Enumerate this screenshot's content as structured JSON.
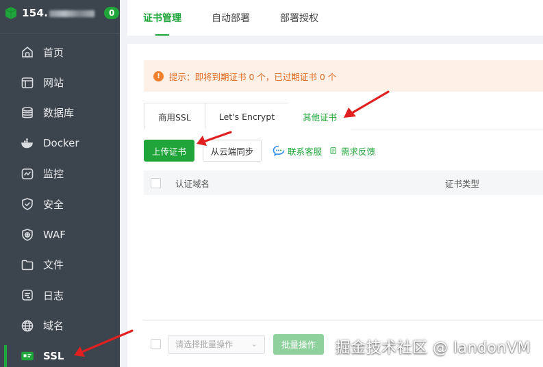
{
  "sidebar": {
    "host_prefix": "154.",
    "badge": "0",
    "items": [
      {
        "label": "首页",
        "icon": "home-icon"
      },
      {
        "label": "网站",
        "icon": "website-icon"
      },
      {
        "label": "数据库",
        "icon": "database-icon"
      },
      {
        "label": "Docker",
        "icon": "docker-icon"
      },
      {
        "label": "监控",
        "icon": "monitor-icon"
      },
      {
        "label": "安全",
        "icon": "shield-icon"
      },
      {
        "label": "WAF",
        "icon": "waf-icon"
      },
      {
        "label": "文件",
        "icon": "folder-icon"
      },
      {
        "label": "日志",
        "icon": "log-icon"
      },
      {
        "label": "域名",
        "icon": "globe-icon"
      },
      {
        "label": "SSL",
        "icon": "ssl-icon",
        "active": true
      }
    ]
  },
  "top_tabs": [
    {
      "label": "证书管理",
      "active": true
    },
    {
      "label": "自动部署"
    },
    {
      "label": "部署授权"
    }
  ],
  "alert": {
    "text": "提示：即将到期证书 0 个，已过期证书 0 个"
  },
  "sub_tabs": [
    {
      "label": "商用SSL"
    },
    {
      "label": "Let's Encrypt"
    },
    {
      "label": "其他证书",
      "active": true
    }
  ],
  "toolbar": {
    "upload_label": "上传证书",
    "sync_label": "从云端同步",
    "support_label": "联系客服",
    "feedback_label": "需求反馈"
  },
  "table": {
    "columns": [
      "认证域名",
      "证书类型"
    ],
    "rows": []
  },
  "footer": {
    "batch_placeholder": "请选择批量操作",
    "batch_button": "批量操作"
  },
  "watermark": "掘金技术社区 @ landonVM",
  "colors": {
    "accent": "#20a53a",
    "sidebar_bg": "#3c444d",
    "warning": "#e26b22",
    "annotation_arrow": "#e02020"
  }
}
